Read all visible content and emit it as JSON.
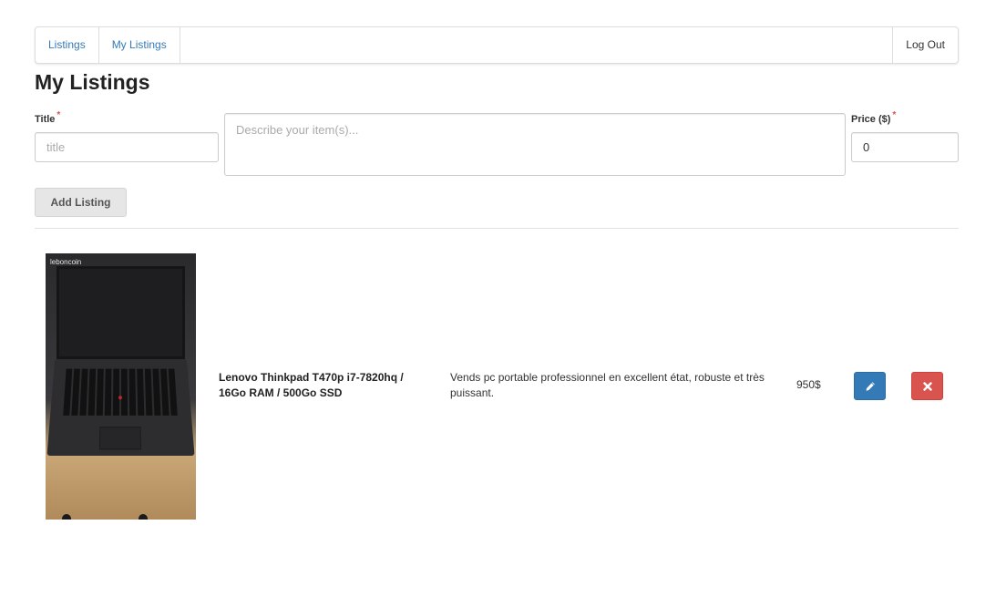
{
  "nav": {
    "listings_label": "Listings",
    "my_listings_label": "My Listings",
    "logout_label": "Log Out"
  },
  "page": {
    "title": "My Listings"
  },
  "form": {
    "title_label": "Title",
    "title_placeholder": "title",
    "description_placeholder": "Describe your item(s)...",
    "price_label": "Price ($)",
    "price_value": "0",
    "required_marker": "*",
    "add_button_label": "Add Listing"
  },
  "listings": [
    {
      "photo_watermark": "leboncoin",
      "title": "Lenovo Thinkpad T470p i7-7820hq / 16Go RAM / 500Go SSD",
      "description": "Vends pc portable professionnel en excellent état, robuste et très puissant.",
      "price": "950$"
    }
  ],
  "icons": {
    "edit": "pencil-icon",
    "delete": "close-icon"
  },
  "colors": {
    "link": "#337ab7",
    "primary": "#337ab7",
    "danger": "#d9534f"
  }
}
